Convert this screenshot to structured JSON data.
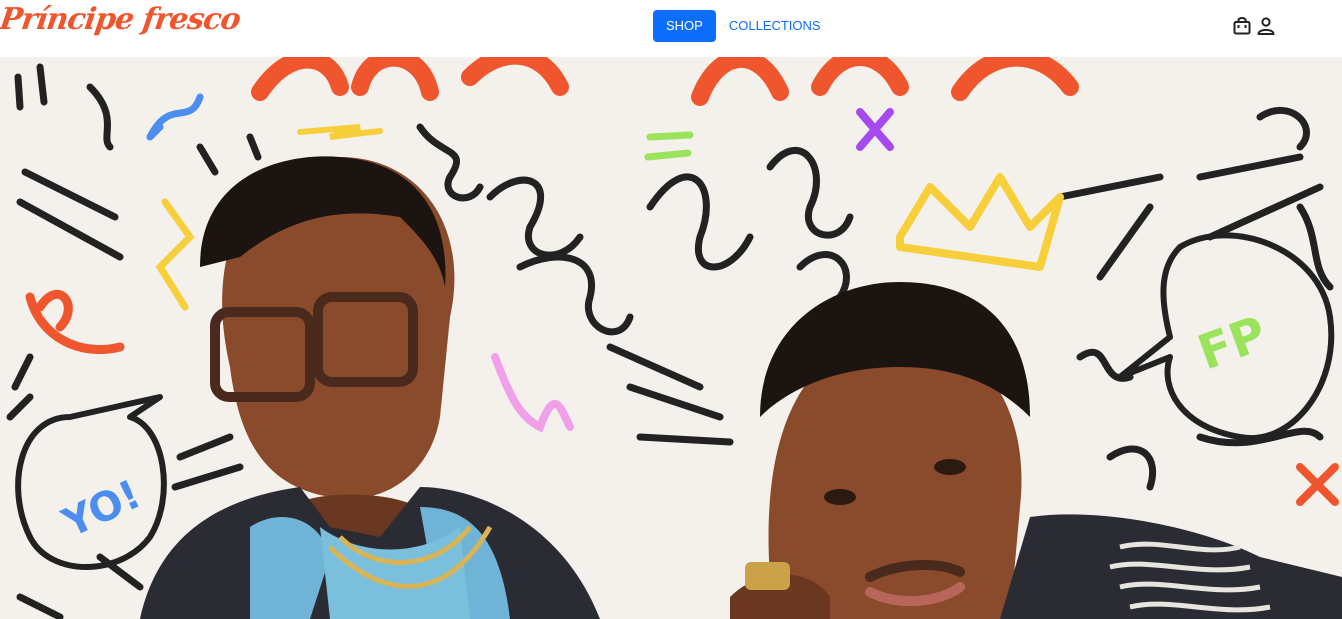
{
  "brand": {
    "logo_text": "Príncipe fresco",
    "color": "#f0562e"
  },
  "nav": {
    "items": [
      {
        "label": "SHOP",
        "active": true
      },
      {
        "label": "COLLECTIONS",
        "active": false
      }
    ],
    "accent": "#0d6efd"
  },
  "icons": {
    "cart": "shopping-bag-icon",
    "account": "user-icon"
  },
  "hero": {
    "image": "two men in front of colorful doodle wall",
    "bubble_left_text": "YO!",
    "bubble_right_text": "FP"
  }
}
